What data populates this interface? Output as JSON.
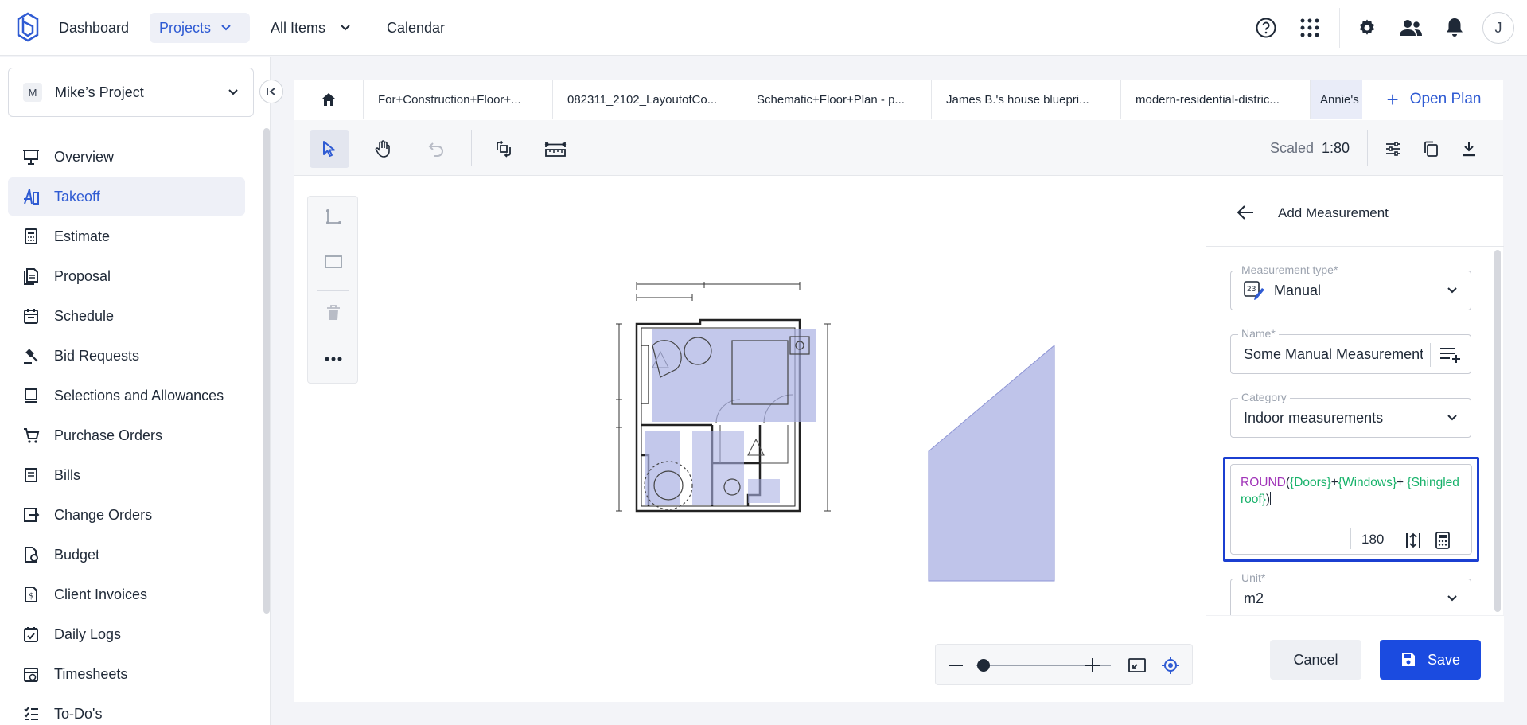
{
  "topnav": {
    "items": [
      {
        "label": "Dashboard"
      },
      {
        "label": "Projects"
      },
      {
        "label": "All Items"
      },
      {
        "label": "Calendar"
      }
    ],
    "user_initial": "J"
  },
  "sidebar": {
    "project_badge": "M",
    "project_name": "Mike’s Project",
    "items": [
      {
        "label": "Overview",
        "icon": "presentation-icon"
      },
      {
        "label": "Takeoff",
        "icon": "takeoff-icon"
      },
      {
        "label": "Estimate",
        "icon": "calculator-icon"
      },
      {
        "label": "Proposal",
        "icon": "document-icon"
      },
      {
        "label": "Schedule",
        "icon": "calendar-icon"
      },
      {
        "label": "Bid Requests",
        "icon": "gavel-icon"
      },
      {
        "label": "Selections and Allowances",
        "icon": "list-icon"
      },
      {
        "label": "Purchase Orders",
        "icon": "cart-icon"
      },
      {
        "label": "Bills",
        "icon": "bill-icon"
      },
      {
        "label": "Change Orders",
        "icon": "change-icon"
      },
      {
        "label": "Budget",
        "icon": "budget-icon"
      },
      {
        "label": "Client Invoices",
        "icon": "invoice-icon"
      },
      {
        "label": "Daily Logs",
        "icon": "log-icon"
      },
      {
        "label": "Timesheets",
        "icon": "timesheet-icon"
      },
      {
        "label": "To-Do's",
        "icon": "todo-icon"
      }
    ]
  },
  "tabs": [
    {
      "label": "For+Construction+Floor+..."
    },
    {
      "label": "082311_2102_LayoutofCo..."
    },
    {
      "label": "Schematic+Floor+Plan - p..."
    },
    {
      "label": "James B.'s house bluepri..."
    },
    {
      "label": "modern-residential-distric..."
    },
    {
      "label": "Annie's"
    }
  ],
  "open_plan_label": "Open Plan",
  "toolbar": {
    "scaled_label": "Scaled",
    "scale_value": "1:80"
  },
  "panel": {
    "title": "Add Measurement",
    "measurement_type": {
      "label": "Measurement type*",
      "value": "Manual"
    },
    "name": {
      "label": "Name*",
      "value": "Some Manual Measurement"
    },
    "category": {
      "label": "Category",
      "value": "Indoor measurements"
    },
    "formula": {
      "fn": "ROUND",
      "open": "(",
      "var1": "{Doors}",
      "plus1": "+",
      "var2": "{Windows}",
      "plus2": "+",
      "var3": "{Shingled roof}",
      "close": ")",
      "result": "180"
    },
    "unit": {
      "label": "Unit*",
      "value": "m2"
    },
    "cancel_label": "Cancel",
    "save_label": "Save"
  },
  "colors": {
    "accent": "#2f5bd3",
    "primary_button": "#1b4be0",
    "formula_function": "#a033b8",
    "formula_variable": "#17b26a",
    "highlight_fill": "#b8bde6"
  }
}
